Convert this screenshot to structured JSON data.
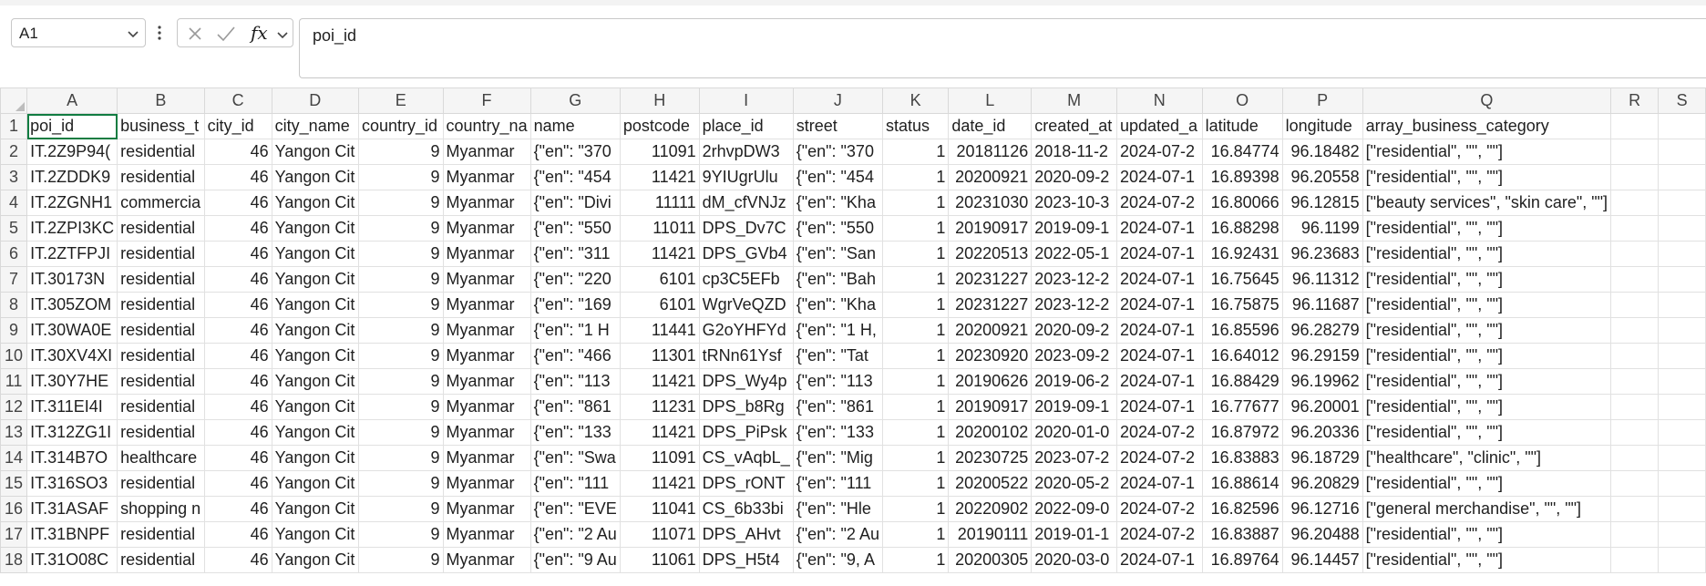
{
  "formula_bar": {
    "name_box": "A1",
    "formula_value": "poi_id",
    "fx_label": "fx"
  },
  "columns": [
    "A",
    "B",
    "C",
    "D",
    "E",
    "F",
    "G",
    "H",
    "I",
    "J",
    "K",
    "L",
    "M",
    "N",
    "O",
    "P",
    "Q",
    "R",
    "S"
  ],
  "rows": [
    {
      "n": "1",
      "cells": [
        "poi_id",
        "business_t",
        "city_id",
        "city_name",
        "country_id",
        "country_na",
        "name",
        "postcode",
        "place_id",
        "street",
        "status",
        "date_id",
        "created_at",
        "updated_a",
        "latitude",
        "longitude",
        "array_business_category",
        "",
        ""
      ]
    },
    {
      "n": "2",
      "cells": [
        "IT.2Z9P94(",
        "residential",
        "46",
        "Yangon Cit",
        "9",
        "Myanmar",
        "{\"en\": \"370",
        "11091",
        "2rhvpDW3",
        "{\"en\": \"370",
        "1",
        "20181126",
        "2018-11-2",
        "2024-07-2",
        "16.84774",
        "96.18482",
        "[\"residential\", \"\", \"\"]",
        "",
        ""
      ]
    },
    {
      "n": "3",
      "cells": [
        "IT.2ZDDK9",
        "residential",
        "46",
        "Yangon Cit",
        "9",
        "Myanmar",
        "{\"en\": \"454",
        "11421",
        "9YIUgrUlu",
        "{\"en\": \"454",
        "1",
        "20200921",
        "2020-09-2",
        "2024-07-1",
        "16.89398",
        "96.20558",
        "[\"residential\", \"\", \"\"]",
        "",
        ""
      ]
    },
    {
      "n": "4",
      "cells": [
        "IT.2ZGNH1",
        "commercia",
        "46",
        "Yangon Cit",
        "9",
        "Myanmar",
        "{\"en\": \"Divi",
        "11111",
        "dM_cfVNJz",
        "{\"en\": \"Kha",
        "1",
        "20231030",
        "2023-10-3",
        "2024-07-2",
        "16.80066",
        "96.12815",
        "[\"beauty services\", \"skin care\", \"\"]",
        "",
        ""
      ]
    },
    {
      "n": "5",
      "cells": [
        "IT.2ZPI3KC",
        "residential",
        "46",
        "Yangon Cit",
        "9",
        "Myanmar",
        "{\"en\": \"550",
        "11011",
        "DPS_Dv7C",
        "{\"en\": \"550",
        "1",
        "20190917",
        "2019-09-1",
        "2024-07-1",
        "16.88298",
        "96.1199",
        "[\"residential\", \"\", \"\"]",
        "",
        ""
      ]
    },
    {
      "n": "6",
      "cells": [
        "IT.2ZTFPJI",
        "residential",
        "46",
        "Yangon Cit",
        "9",
        "Myanmar",
        "{\"en\": \"311",
        "11421",
        "DPS_GVb4",
        "{\"en\": \"San",
        "1",
        "20220513",
        "2022-05-1",
        "2024-07-1",
        "16.92431",
        "96.23683",
        "[\"residential\", \"\", \"\"]",
        "",
        ""
      ]
    },
    {
      "n": "7",
      "cells": [
        "IT.30173N",
        "residential",
        "46",
        "Yangon Cit",
        "9",
        "Myanmar",
        "{\"en\": \"220",
        "6101",
        "cp3C5EFb",
        "{\"en\": \"Bah",
        "1",
        "20231227",
        "2023-12-2",
        "2024-07-1",
        "16.75645",
        "96.11312",
        "[\"residential\", \"\", \"\"]",
        "",
        ""
      ]
    },
    {
      "n": "8",
      "cells": [
        "IT.305ZOM",
        "residential",
        "46",
        "Yangon Cit",
        "9",
        "Myanmar",
        "{\"en\": \"169",
        "6101",
        "WgrVeQZD",
        "{\"en\": \"Kha",
        "1",
        "20231227",
        "2023-12-2",
        "2024-07-1",
        "16.75875",
        "96.11687",
        "[\"residential\", \"\", \"\"]",
        "",
        ""
      ]
    },
    {
      "n": "9",
      "cells": [
        "IT.30WA0E",
        "residential",
        "46",
        "Yangon Cit",
        "9",
        "Myanmar",
        "{\"en\": \"1 H",
        "11441",
        "G2oYHFYd",
        "{\"en\": \"1 H,",
        "1",
        "20200921",
        "2020-09-2",
        "2024-07-1",
        "16.85596",
        "96.28279",
        "[\"residential\", \"\", \"\"]",
        "",
        ""
      ]
    },
    {
      "n": "10",
      "cells": [
        "IT.30XV4XI",
        "residential",
        "46",
        "Yangon Cit",
        "9",
        "Myanmar",
        "{\"en\": \"466",
        "11301",
        "tRNn61Ysf",
        "{\"en\": \"Tat",
        "1",
        "20230920",
        "2023-09-2",
        "2024-07-1",
        "16.64012",
        "96.29159",
        "[\"residential\", \"\", \"\"]",
        "",
        ""
      ]
    },
    {
      "n": "11",
      "cells": [
        "IT.30Y7HE",
        "residential",
        "46",
        "Yangon Cit",
        "9",
        "Myanmar",
        "{\"en\": \"113",
        "11421",
        "DPS_Wy4p",
        "{\"en\": \"113",
        "1",
        "20190626",
        "2019-06-2",
        "2024-07-1",
        "16.88429",
        "96.19962",
        "[\"residential\", \"\", \"\"]",
        "",
        ""
      ]
    },
    {
      "n": "12",
      "cells": [
        "IT.311EI4I",
        "residential",
        "46",
        "Yangon Cit",
        "9",
        "Myanmar",
        "{\"en\": \"861",
        "11231",
        "DPS_b8Rg",
        "{\"en\": \"861",
        "1",
        "20190917",
        "2019-09-1",
        "2024-07-1",
        "16.77677",
        "96.20001",
        "[\"residential\", \"\", \"\"]",
        "",
        ""
      ]
    },
    {
      "n": "13",
      "cells": [
        "IT.312ZG1I",
        "residential",
        "46",
        "Yangon Cit",
        "9",
        "Myanmar",
        "{\"en\": \"133",
        "11421",
        "DPS_PiPsk",
        "{\"en\": \"133",
        "1",
        "20200102",
        "2020-01-0",
        "2024-07-2",
        "16.87972",
        "96.20336",
        "[\"residential\", \"\", \"\"]",
        "",
        ""
      ]
    },
    {
      "n": "14",
      "cells": [
        "IT.314B7O",
        "healthcare",
        "46",
        "Yangon Cit",
        "9",
        "Myanmar",
        "{\"en\": \"Swa",
        "11091",
        "CS_vAqbL_",
        "{\"en\": \"Mig",
        "1",
        "20230725",
        "2023-07-2",
        "2024-07-2",
        "16.83883",
        "96.18729",
        "[\"healthcare\", \"clinic\", \"\"]",
        "",
        ""
      ]
    },
    {
      "n": "15",
      "cells": [
        "IT.316SO3",
        "residential",
        "46",
        "Yangon Cit",
        "9",
        "Myanmar",
        "{\"en\": \"111",
        "11421",
        "DPS_rONT",
        "{\"en\": \"111",
        "1",
        "20200522",
        "2020-05-2",
        "2024-07-1",
        "16.88614",
        "96.20829",
        "[\"residential\", \"\", \"\"]",
        "",
        ""
      ]
    },
    {
      "n": "16",
      "cells": [
        "IT.31ASAF",
        "shopping n",
        "46",
        "Yangon Cit",
        "9",
        "Myanmar",
        "{\"en\": \"EVE",
        "11041",
        "CS_6b33bi",
        "{\"en\": \"Hle",
        "1",
        "20220902",
        "2022-09-0",
        "2024-07-2",
        "16.82596",
        "96.12716",
        "[\"general merchandise\", \"\", \"\"]",
        "",
        ""
      ]
    },
    {
      "n": "17",
      "cells": [
        "IT.31BNPF",
        "residential",
        "46",
        "Yangon Cit",
        "9",
        "Myanmar",
        "{\"en\": \"2 Au",
        "11071",
        "DPS_AHvt",
        "{\"en\": \"2 Au",
        "1",
        "20190111",
        "2019-01-1",
        "2024-07-2",
        "16.83887",
        "96.20488",
        "[\"residential\", \"\", \"\"]",
        "",
        ""
      ]
    },
    {
      "n": "18",
      "cells": [
        "IT.31O08C",
        "residential",
        "46",
        "Yangon Cit",
        "9",
        "Myanmar",
        "{\"en\": \"9 Au",
        "11061",
        "DPS_H5t4",
        "{\"en\": \"9, A",
        "1",
        "20200305",
        "2020-03-0",
        "2024-07-1",
        "16.89764",
        "96.14457",
        "[\"residential\", \"\", \"\"]",
        "",
        ""
      ]
    }
  ]
}
